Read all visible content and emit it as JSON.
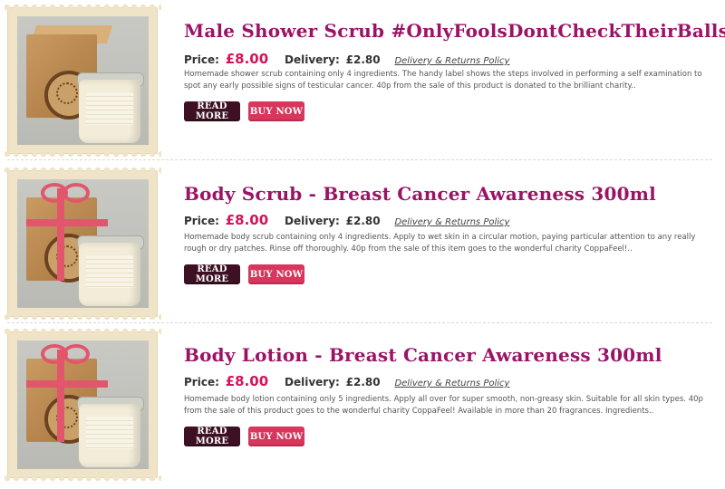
{
  "products": [
    {
      "title": "Male Shower Scrub #OnlyFoolsDontCheckTheirBalls",
      "price_label": "Price:",
      "price": "£8.00",
      "delivery_label": "Delivery:",
      "delivery": "£2.80",
      "policy_link": "Delivery & Returns Policy",
      "description": "Homemade shower scrub containing only 4 ingredients. The handy label shows the steps involved in performing a self examination to spot any early possible signs of testicular cancer. 40p from the sale of this product is donated to the brilliant charity..",
      "read_more": "READ MORE",
      "buy_now": "BUY NOW"
    },
    {
      "title": "Body Scrub - Breast Cancer Awareness 300ml",
      "price_label": "Price:",
      "price": "£8.00",
      "delivery_label": "Delivery:",
      "delivery": "£2.80",
      "policy_link": "Delivery & Returns Policy",
      "description": "Homemade body scrub containing only 4 ingredients. Apply to wet skin in a circular motion, paying particular attention to any really rough or dry patches. Rinse off thoroughly. 40p from the sale of this item goes to the wonderful charity CoppaFeel!..",
      "read_more": "READ MORE",
      "buy_now": "BUY NOW"
    },
    {
      "title": "Body Lotion - Breast Cancer Awareness 300ml",
      "price_label": "Price:",
      "price": "£8.00",
      "delivery_label": "Delivery:",
      "delivery": "£2.80",
      "policy_link": "Delivery & Returns Policy",
      "description": "Homemade body lotion containing only 5 ingredients. Apply all over for super smooth, non-greasy skin. Suitable for all skin types. 40p from the sale of this product goes to the wonderful charity CoppaFeel! Available in more than 20 fragrances. Ingredients..",
      "read_more": "READ MORE",
      "buy_now": "BUY NOW"
    }
  ],
  "colors": {
    "title": "#9a1466",
    "price": "#d4145a",
    "read_more_button": "#3d1023",
    "buy_now_button": "#d8365c",
    "stamp_frame": "#efe4c8"
  }
}
